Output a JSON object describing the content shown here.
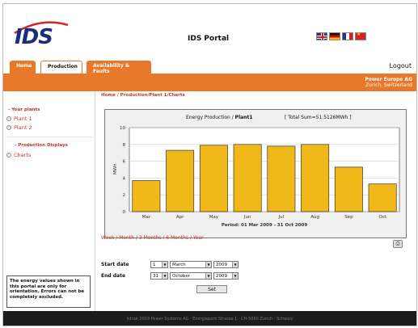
{
  "header": {
    "logo_text": "IDS",
    "portal_title": "IDS Portal",
    "languages": [
      "english-flag",
      "german-flag",
      "french-flag",
      "chinese-flag"
    ]
  },
  "tabs": {
    "home": "Home",
    "production": "Production",
    "availability": "Availability & Faults"
  },
  "logout": "Logout",
  "company": {
    "name": "Power Europe AG",
    "location": "Zurich, Switzerland"
  },
  "sidebar": {
    "plants_header": "- Your plants",
    "plants": [
      "Plant 1",
      "Plant 2"
    ],
    "displays_header": "- Production Displays",
    "displays": [
      "Charts"
    ],
    "notice": "The energy values shown in this portal are only for orientation. Errors can not be completely excluded."
  },
  "breadcrumb": "Home / Production/Plant 1/Charts",
  "chart": {
    "title_prefix": "Energy Production / ",
    "title_plant": "Plant1",
    "total": "[ Total Sum=51.5126MWh ]",
    "period": "Period: 01 Mar 2009 - 31 Oct 2009"
  },
  "chart_data": {
    "type": "bar",
    "categories": [
      "Mar",
      "Apr",
      "May",
      "Jun",
      "Jul",
      "Aug",
      "Sep",
      "Oct"
    ],
    "values": [
      3.7,
      7.3,
      7.9,
      8.0,
      7.8,
      8.0,
      5.3,
      3.3
    ],
    "ylabel": "MWh",
    "ylim": [
      0,
      10
    ],
    "yticks": [
      0,
      2,
      4,
      6,
      8,
      10
    ],
    "grid": true,
    "bar_color": "#f0b818"
  },
  "period_links": "Week / Month / 3 Months / 6 Months / Year",
  "form": {
    "start_label": "Start date",
    "start_day": "1",
    "start_month": "March",
    "start_year": "2009",
    "end_label": "End date",
    "end_day": "31",
    "end_month": "October",
    "end_year": "2009",
    "set_label": "Set"
  },
  "footer": "Istrak 2009 Power Systems AG · Energiepark Strasse 1 · CH-5000 Zurich · Schweiz",
  "colors": {
    "accent": "#e9792a",
    "link": "#c0392b",
    "footer_bg": "#1c1c1c"
  }
}
